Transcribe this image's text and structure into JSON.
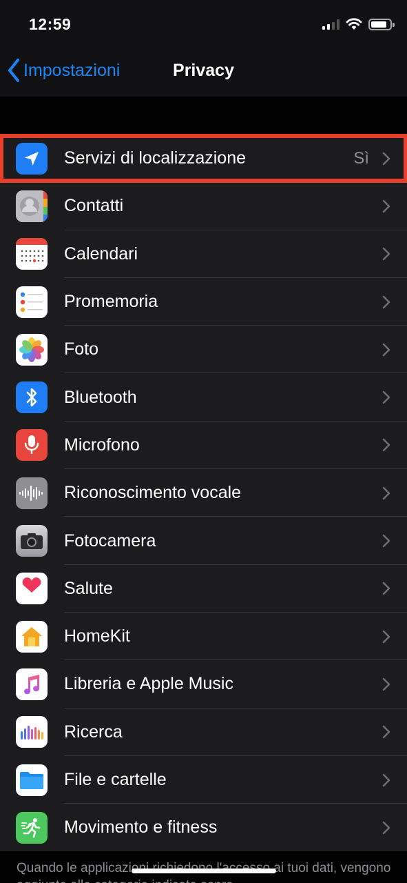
{
  "status": {
    "time": "12:59"
  },
  "nav": {
    "back_label": "Impostazioni",
    "title": "Privacy"
  },
  "rows": [
    {
      "label": "Servizi di localizzazione",
      "value": "Sì",
      "icon": "location-arrow-icon",
      "color": "#1f7ef5"
    },
    {
      "label": "Contatti",
      "value": "",
      "icon": "contacts-icon",
      "color": "#c7c7cc"
    },
    {
      "label": "Calendari",
      "value": "",
      "icon": "calendar-icon",
      "color": "#ffffff"
    },
    {
      "label": "Promemoria",
      "value": "",
      "icon": "reminders-icon",
      "color": "#ffffff"
    },
    {
      "label": "Foto",
      "value": "",
      "icon": "photos-icon",
      "color": "#ffffff"
    },
    {
      "label": "Bluetooth",
      "value": "",
      "icon": "bluetooth-icon",
      "color": "#1f7ef5"
    },
    {
      "label": "Microfono",
      "value": "",
      "icon": "microphone-icon",
      "color": "#e8463c"
    },
    {
      "label": "Riconoscimento vocale",
      "value": "",
      "icon": "speech-waveform-icon",
      "color": "#8e8e93"
    },
    {
      "label": "Fotocamera",
      "value": "",
      "icon": "camera-icon",
      "color": "#8e8e93"
    },
    {
      "label": "Salute",
      "value": "",
      "icon": "heart-icon",
      "color": "#ffffff"
    },
    {
      "label": "HomeKit",
      "value": "",
      "icon": "home-icon",
      "color": "#ffffff"
    },
    {
      "label": "Libreria e Apple Music",
      "value": "",
      "icon": "music-note-icon",
      "color": "#ffffff"
    },
    {
      "label": "Ricerca",
      "value": "",
      "icon": "research-bars-icon",
      "color": "#ffffff"
    },
    {
      "label": "File e cartelle",
      "value": "",
      "icon": "folder-icon",
      "color": "#ffffff"
    },
    {
      "label": "Movimento e fitness",
      "value": "",
      "icon": "running-figure-icon",
      "color": "#4cc85f"
    }
  ],
  "footer": {
    "text": "Quando le applicazioni richiedono l'accesso ai tuoi dati, vengono aggiunte alle categorie indicate sopra."
  },
  "highlight_color": "#e8402b"
}
